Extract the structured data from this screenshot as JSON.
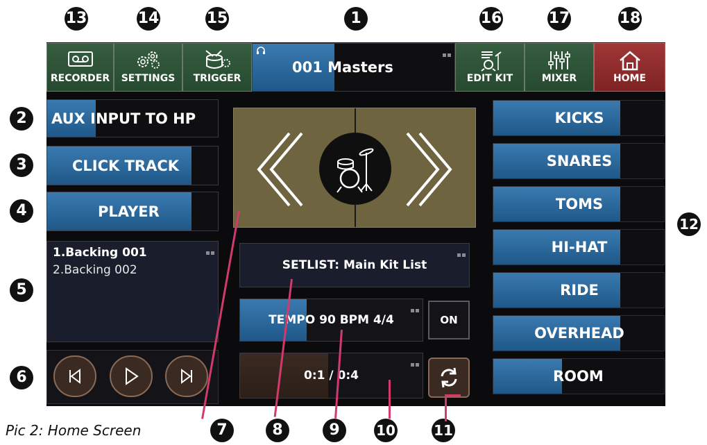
{
  "caption": "Pic 2: Home Screen",
  "callouts": [
    "1",
    "2",
    "3",
    "4",
    "5",
    "6",
    "7",
    "8",
    "9",
    "10",
    "11",
    "12",
    "13",
    "14",
    "15",
    "16",
    "17",
    "18"
  ],
  "top_buttons": {
    "recorder": "RECORDER",
    "settings": "SETTINGS",
    "trigger": "TRIGGER",
    "edit_kit": "EDIT KIT",
    "mixer": "MIXER",
    "home": "HOME"
  },
  "kit": {
    "name": "001 Masters",
    "fill_fraction": 0.42
  },
  "aux": {
    "label": "AUX INPUT TO HP",
    "fill_fraction": 0.28
  },
  "click_track": {
    "label": "CLICK TRACK",
    "fill_fraction": 0.84
  },
  "player": {
    "label": "PLAYER",
    "fill_fraction": 0.84
  },
  "playlist": {
    "items": [
      "1.Backing 001",
      "2.Backing 002"
    ]
  },
  "setlist": {
    "label": "SETLIST: Main Kit List"
  },
  "tempo": {
    "label": "TEMPO 90 BPM 4/4",
    "fill_fraction": 0.36,
    "toggle": "ON"
  },
  "time": {
    "label": "0:1 / 0:4",
    "fill_fraction": 0.48
  },
  "categories": [
    {
      "label": "KICKS",
      "fill_fraction": 0.74
    },
    {
      "label": "SNARES",
      "fill_fraction": 0.74
    },
    {
      "label": "TOMS",
      "fill_fraction": 0.74
    },
    {
      "label": "HI-HAT",
      "fill_fraction": 0.74
    },
    {
      "label": "RIDE",
      "fill_fraction": 0.74
    },
    {
      "label": "OVERHEAD",
      "fill_fraction": 0.74
    },
    {
      "label": "ROOM",
      "fill_fraction": 0.4
    }
  ],
  "colors": {
    "accent_blue": "#2f6fa3",
    "home_red": "#8e2a2a",
    "nav_green": "#2d5538",
    "kit_gold": "#6e6440",
    "pointer": "#d13a6a"
  },
  "icons": [
    "tape-icon",
    "gears-icon",
    "drum-trigger-icon",
    "headphone-icon",
    "edit-kit-icon",
    "mixer-icon",
    "home-icon",
    "drum-kit-icon",
    "prev-track-icon",
    "play-icon",
    "next-track-icon",
    "refresh-icon"
  ]
}
